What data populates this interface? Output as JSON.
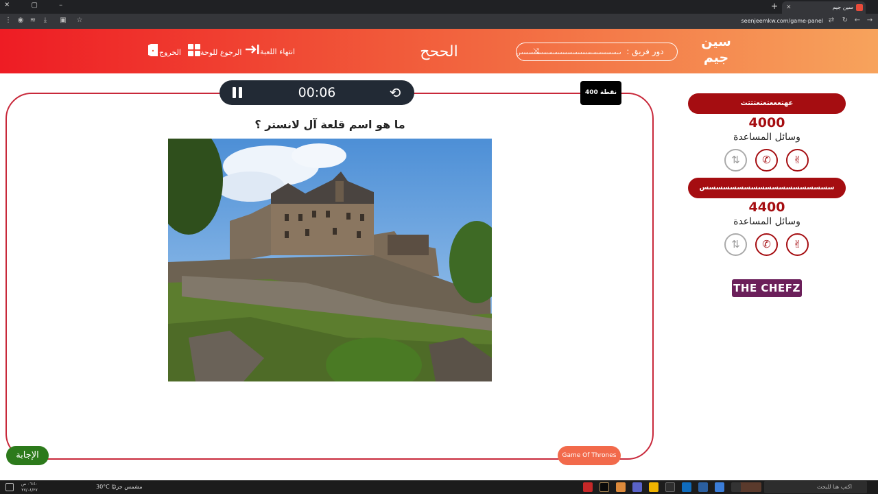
{
  "browser": {
    "tab_title": "سين جيم",
    "url": "seenjeemkw.com/game-panel"
  },
  "header": {
    "logo": "سين جيم",
    "turn_label": "دور فريق :",
    "turn_team": "سسسسسسسسسسسسسسسسسسسسس",
    "category_title": "الححح",
    "end_game": "انتهاء اللعبة",
    "back_to_board": "الرجوع للوحة",
    "exit": "الخروج"
  },
  "timer": {
    "time": "00:06"
  },
  "points": "400 نقطة",
  "question": "ما هو اسم قلعة آل لانستر ؟",
  "answer_button": "الإجابة",
  "category_tag": "Game Of Thrones",
  "teams": [
    {
      "name": "عهتعععتعتعتثثث",
      "score": "4000",
      "aids_label": "وسائل المساعدة"
    },
    {
      "name": "سسسسسسسسسسسسسسسسسسس",
      "score": "4400",
      "aids_label": "وسائل المساعدة"
    }
  ],
  "sponsor": "THE CHEFZ",
  "taskbar": {
    "search_placeholder": "اكتب هنا للبحث",
    "weather": "30°C  مشمس جزئيًا",
    "time": "٠٦:٤٠ ص",
    "date": "٢٧/٠٤/٢٧"
  },
  "colors": {
    "accent": "#a50d11",
    "header_start": "#ee1c24",
    "header_end": "#f7a35c",
    "answer_green": "#2c7a1b",
    "tag_orange": "#f26a4b"
  }
}
